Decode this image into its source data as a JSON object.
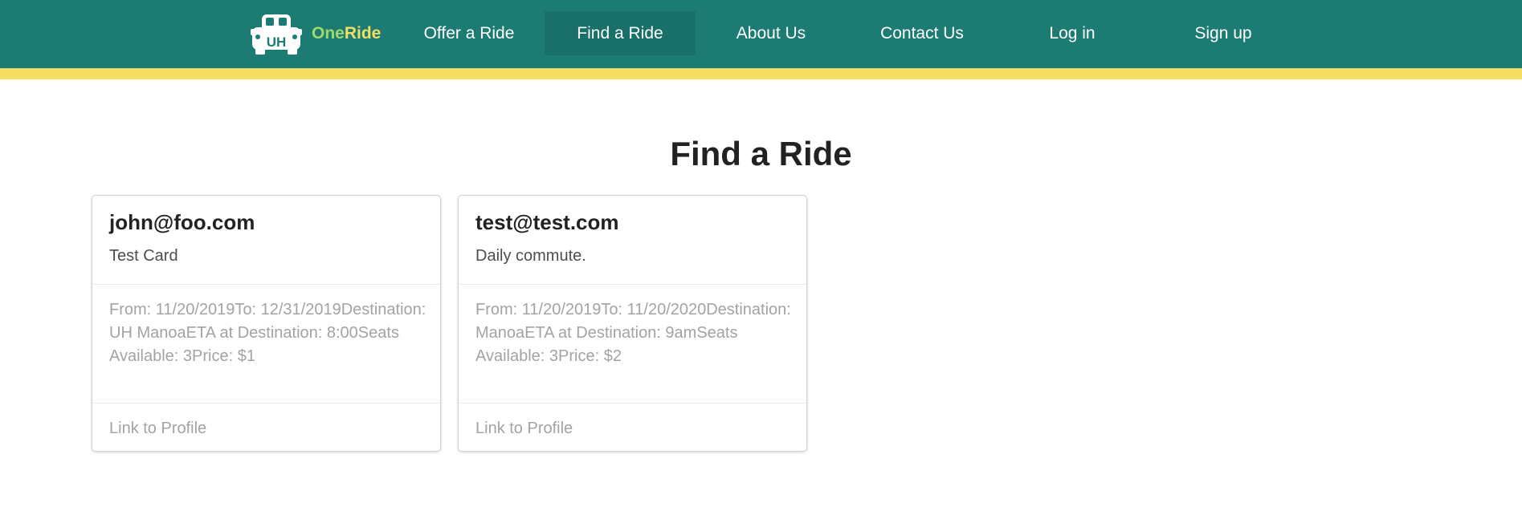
{
  "navbar": {
    "logo": {
      "badge": "UH",
      "brand_part1": "One",
      "brand_part2": "Ride"
    },
    "items": [
      {
        "label": "Offer a Ride",
        "active": false
      },
      {
        "label": "Find a Ride",
        "active": true
      },
      {
        "label": "About Us",
        "active": false
      },
      {
        "label": "Contact Us",
        "active": false
      },
      {
        "label": "Log in",
        "active": false
      },
      {
        "label": "Sign up",
        "active": false
      }
    ]
  },
  "colors": {
    "navbar_bg": "#1c7b73",
    "stripe": "#f3de63",
    "brand_one": "#9fd96c",
    "brand_ride": "#f3de63"
  },
  "main": {
    "title": "Find a Ride",
    "cards": [
      {
        "header": "john@foo.com",
        "meta": "Test Card",
        "details": "From: 11/20/2019To: 12/31/2019Destination: UH ManoaETA at Destination: 8:00Seats Available: 3Price: $1",
        "link": "Link to Profile"
      },
      {
        "header": "test@test.com",
        "meta": "Daily commute.",
        "details": "From: 11/20/2019To: 11/20/2020Destination: ManoaETA at Destination: 9amSeats Available: 3Price: $2",
        "link": "Link to Profile"
      }
    ]
  }
}
